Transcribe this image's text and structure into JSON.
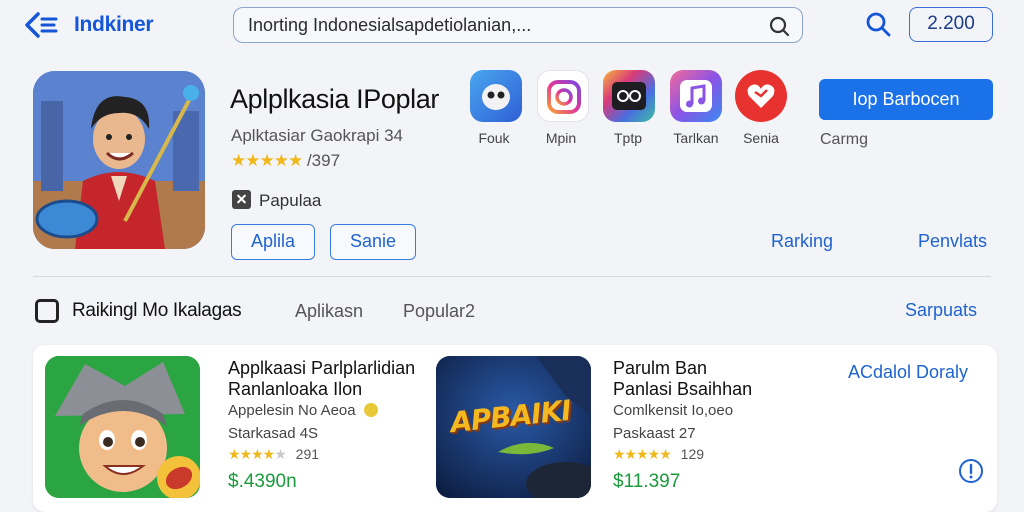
{
  "header": {
    "back_icon": "back-arrow-icon",
    "brand": "Indkiner",
    "search": {
      "value": "Inorting Indonesialsapdetiolanian,...",
      "icon": "search-icon"
    },
    "coins": "2.200"
  },
  "hero": {
    "title": "Aplplkasia IPoplar",
    "subtitle": "Aplktasiar Gaokrapi 34",
    "rating_stars": "★★★★★",
    "rating_count": "/397",
    "tag": "Papulaa",
    "buttons": [
      "Aplila",
      "Sanie"
    ],
    "apps": [
      {
        "label": "Fouk",
        "color": "#3b6dd8"
      },
      {
        "label": "Mpin",
        "color": "#e04a9c"
      },
      {
        "label": "Tptp",
        "color": "#7a3ad0"
      },
      {
        "label": "Tarlkan",
        "color": "#8b53e6"
      },
      {
        "label": "Senia",
        "color": "#e8322f"
      }
    ],
    "primary_button": "Iop Barbocen",
    "caption": "Carmg",
    "links": [
      "Rarking",
      "Penvlats"
    ]
  },
  "section": {
    "title": "Raikingl Mo Ikalagas",
    "tabs": [
      "Aplikasn",
      "Popular2"
    ],
    "link": "Sarpuats"
  },
  "list": {
    "action": "ACdalol Doraly",
    "items": [
      {
        "title_line1": "Applkaasi Parlplarlidian",
        "title_line2": "Ranlanloaka Ilon",
        "meta1": "Appelesin No Aeoa",
        "meta2": "Starkasad 4S",
        "stars": 4,
        "rating": "291",
        "price": "$.4390n"
      },
      {
        "title_line1": "Parulm Ban",
        "title_line2": "Panlasi Bsaihhan",
        "meta1": "Comlkensit Io,oeo",
        "meta2": "Paskaast 27",
        "stars": 5,
        "rating": "129",
        "price": "$11.397",
        "art_text": "APBAIKI"
      }
    ]
  }
}
